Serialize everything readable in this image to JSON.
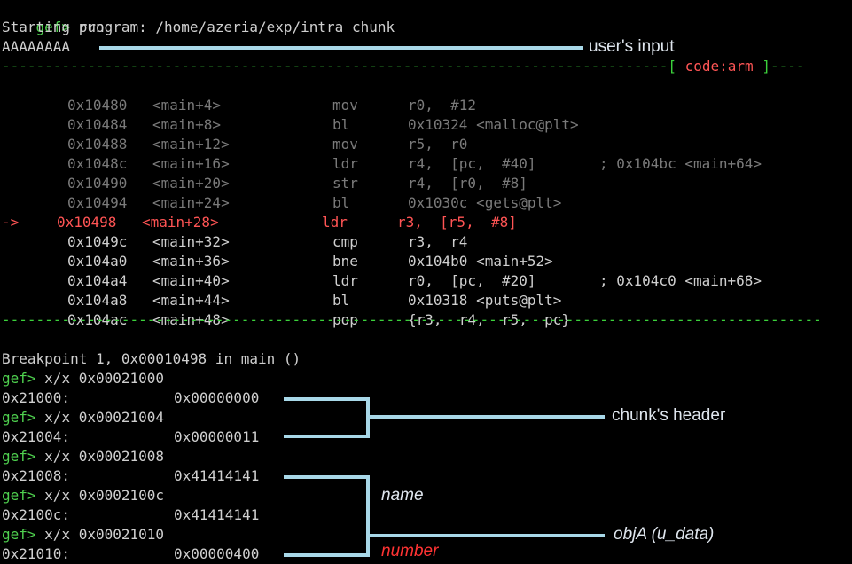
{
  "prompt": "gef>",
  "header": {
    "run_cmd": "run",
    "starting": "Starting program: /home/azeria/exp/intra_chunk",
    "input": "AAAAAAAA"
  },
  "separator": {
    "top_dashes": "------------------------------------------------------------------------------[ ",
    "tag": "code:arm",
    "top_tail": " ]----",
    "bottom": "------------------------------------------------------------------------------------------------"
  },
  "disasm": [
    {
      "addr": "0x10480",
      "sym": "<main+4>",
      "mn": "mov",
      "ops": "r0,  #12",
      "cmt": ""
    },
    {
      "addr": "0x10484",
      "sym": "<main+8>",
      "mn": "bl",
      "ops": "0x10324 <malloc@plt>",
      "cmt": ""
    },
    {
      "addr": "0x10488",
      "sym": "<main+12>",
      "mn": "mov",
      "ops": "r5,  r0",
      "cmt": ""
    },
    {
      "addr": "0x1048c",
      "sym": "<main+16>",
      "mn": "ldr",
      "ops": "r4,  [pc,  #40]",
      "cmt": "; 0x104bc <main+64>"
    },
    {
      "addr": "0x10490",
      "sym": "<main+20>",
      "mn": "str",
      "ops": "r4,  [r0,  #8]",
      "cmt": ""
    },
    {
      "addr": "0x10494",
      "sym": "<main+24>",
      "mn": "bl",
      "ops": "0x1030c <gets@plt>",
      "cmt": ""
    },
    {
      "addr": "0x10498",
      "sym": "<main+28>",
      "mn": "ldr",
      "ops": "r3,  [r5,  #8]",
      "cmt": "",
      "current": true,
      "arrow": "->"
    },
    {
      "addr": "0x1049c",
      "sym": "<main+32>",
      "mn": "cmp",
      "ops": "r3,  r4",
      "cmt": ""
    },
    {
      "addr": "0x104a0",
      "sym": "<main+36>",
      "mn": "bne",
      "ops": "0x104b0 <main+52>",
      "cmt": ""
    },
    {
      "addr": "0x104a4",
      "sym": "<main+40>",
      "mn": "ldr",
      "ops": "r0,  [pc,  #20]",
      "cmt": "; 0x104c0 <main+68>"
    },
    {
      "addr": "0x104a8",
      "sym": "<main+44>",
      "mn": "bl",
      "ops": "0x10318 <puts@plt>",
      "cmt": ""
    },
    {
      "addr": "0x104ac",
      "sym": "<main+48>",
      "mn": "pop",
      "ops": "{r3,  r4,  r5,  pc}",
      "cmt": ""
    }
  ],
  "breakpoint": "Breakpoint 1, 0x00010498 in main ()",
  "memory": [
    {
      "cmd": "x/x 0x00021000",
      "addr": "0x21000:",
      "val": "0x00000000"
    },
    {
      "cmd": "x/x 0x00021004",
      "addr": "0x21004:",
      "val": "0x00000011"
    },
    {
      "cmd": "x/x 0x00021008",
      "addr": "0x21008:",
      "val": "0x41414141"
    },
    {
      "cmd": "x/x 0x0002100c",
      "addr": "0x2100c:",
      "val": "0x41414141"
    },
    {
      "cmd": "x/x 0x00021010",
      "addr": "0x21010:",
      "val": "0x00000400"
    }
  ],
  "annotations": {
    "user_input": "user's input",
    "chunk_header": "chunk's header",
    "name": "name",
    "number": "number",
    "obja": "objA (u_data)"
  },
  "colors": {
    "background": "#000000",
    "prompt": "#4fd14f",
    "text": "#cfcfcf",
    "dim": "#7a7a7a",
    "current": "#ff5454",
    "annotation_line": "#a8d8e8",
    "number_label": "#ff3333"
  }
}
